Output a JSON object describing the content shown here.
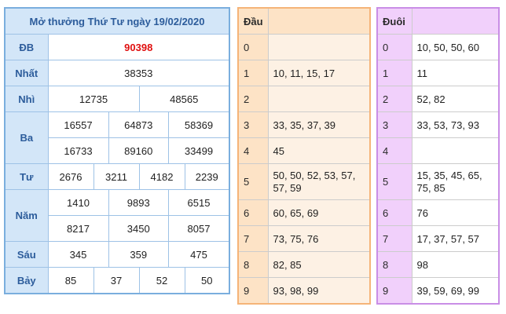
{
  "results": {
    "title": "Mở thưởng Thứ Tư ngày 19/02/2020",
    "db": {
      "label": "ĐB",
      "values": [
        "90398"
      ]
    },
    "nhat": {
      "label": "Nhất",
      "values": [
        "38353"
      ]
    },
    "nhi": {
      "label": "Nhì",
      "values": [
        "12735",
        "48565"
      ]
    },
    "ba": {
      "label": "Ba",
      "values": [
        "16557",
        "64873",
        "58369",
        "16733",
        "89160",
        "33499"
      ]
    },
    "tu": {
      "label": "Tư",
      "values": [
        "2676",
        "3211",
        "4182",
        "2239"
      ]
    },
    "nam": {
      "label": "Năm",
      "values": [
        "1410",
        "9893",
        "6515",
        "8217",
        "3450",
        "8057"
      ]
    },
    "sau": {
      "label": "Sáu",
      "values": [
        "345",
        "359",
        "475"
      ]
    },
    "bay": {
      "label": "Bảy",
      "values": [
        "85",
        "37",
        "52",
        "50"
      ]
    }
  },
  "dau": {
    "header": "Đầu",
    "rows": [
      {
        "key": "0",
        "val": ""
      },
      {
        "key": "1",
        "val": "10, 11, 15, 17"
      },
      {
        "key": "2",
        "val": ""
      },
      {
        "key": "3",
        "val": "33, 35, 37, 39"
      },
      {
        "key": "4",
        "val": "45"
      },
      {
        "key": "5",
        "val": "50, 50, 52, 53, 57, 57, 59"
      },
      {
        "key": "6",
        "val": "60, 65, 69"
      },
      {
        "key": "7",
        "val": "73, 75, 76"
      },
      {
        "key": "8",
        "val": "82, 85"
      },
      {
        "key": "9",
        "val": "93, 98, 99"
      }
    ]
  },
  "duoi": {
    "header": "Đuôi",
    "rows": [
      {
        "key": "0",
        "val": "10, 50, 50, 60"
      },
      {
        "key": "1",
        "val": "11"
      },
      {
        "key": "2",
        "val": "52, 82"
      },
      {
        "key": "3",
        "val": "33, 53, 73, 93"
      },
      {
        "key": "4",
        "val": ""
      },
      {
        "key": "5",
        "val": "15, 35, 45, 65, 75, 85"
      },
      {
        "key": "6",
        "val": "76"
      },
      {
        "key": "7",
        "val": "17, 37, 57, 57"
      },
      {
        "key": "8",
        "val": "98"
      },
      {
        "key": "9",
        "val": "39, 59, 69, 99"
      }
    ]
  }
}
